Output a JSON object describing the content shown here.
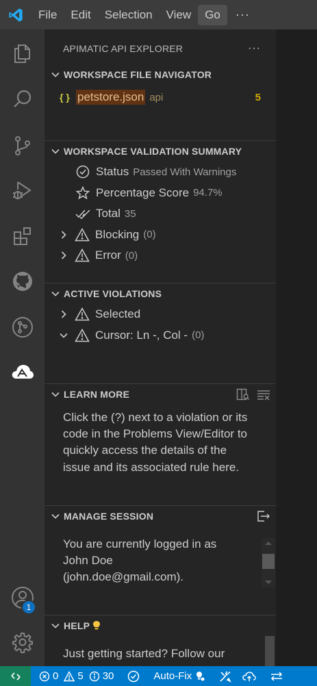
{
  "menu": {
    "file": "File",
    "edit": "Edit",
    "selection": "Selection",
    "view": "View",
    "go": "Go",
    "more": "···"
  },
  "activity": {
    "accounts_badge": "1"
  },
  "panel": {
    "title": "APIMATIC API EXPLORER",
    "more": "···"
  },
  "file_navigator": {
    "title": "WORKSPACE FILE NAVIGATOR",
    "file_icon": "{ }",
    "file_name": "petstore.json",
    "file_folder": "api",
    "file_count": "5"
  },
  "validation_summary": {
    "title": "WORKSPACE VALIDATION SUMMARY",
    "status_label": "Status",
    "status_value": "Passed With Warnings",
    "score_label": "Percentage Score",
    "score_value": "94.7%",
    "total_label": "Total",
    "total_value": "35",
    "blocking_label": "Blocking",
    "blocking_value": "(0)",
    "error_label": "Error",
    "error_value": "(0)"
  },
  "active_violations": {
    "title": "ACTIVE VIOLATIONS",
    "selected_label": "Selected",
    "cursor_label": "Cursor: Ln -, Col -",
    "cursor_value": "(0)"
  },
  "learn_more": {
    "title": "LEARN MORE",
    "text": "Click the (?) next to a violation or its code in the Problems View/Editor to quickly access the details of the issue and its associated rule here."
  },
  "manage_session": {
    "title": "MANAGE SESSION",
    "text": "You are currently logged in as John Doe (john.doe@gmail.com)."
  },
  "help": {
    "title": "HELP",
    "text": "Just getting started? Follow our"
  },
  "statusbar": {
    "errors": "0",
    "warnings": "5",
    "info": "30",
    "autofix": "Auto-Fix"
  },
  "colors": {
    "accent": "#007acc",
    "remote": "#16825d",
    "selection_highlight": "#613214",
    "file_name": "#e2c08d",
    "count": "#cca700"
  }
}
